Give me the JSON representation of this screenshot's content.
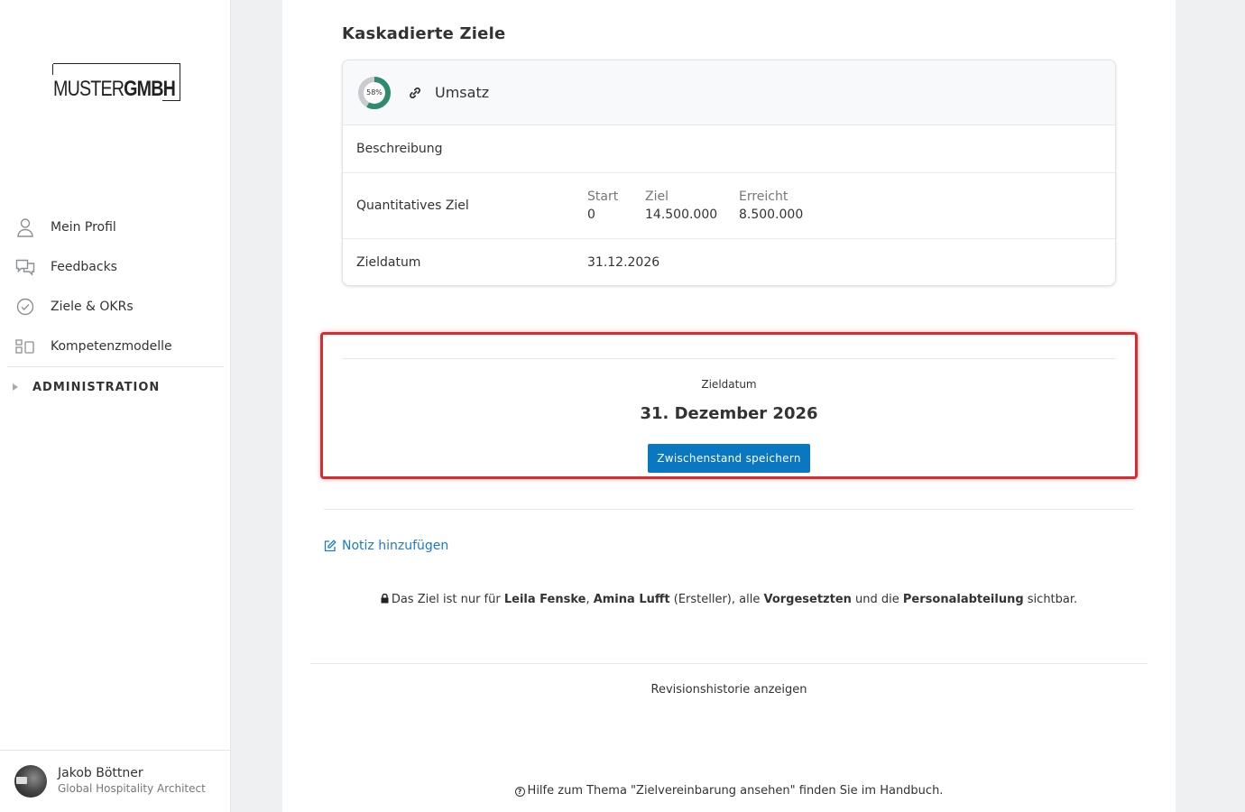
{
  "brand": {
    "logo_text_light": "MUSTER",
    "logo_text_bold": "GMBH"
  },
  "sidebar": {
    "items": [
      {
        "label": "Mein Profil",
        "icon": "user-icon"
      },
      {
        "label": "Feedbacks",
        "icon": "chat-icon"
      },
      {
        "label": "Ziele & OKRs",
        "icon": "check-circle-icon"
      },
      {
        "label": "Kompetenzmodelle",
        "icon": "blocks-icon"
      }
    ],
    "admin_label": "ADMINISTRATION"
  },
  "user": {
    "name": "Jakob Böttner",
    "role": "Global Hospitality Architect"
  },
  "main": {
    "section_title": "Kaskadierte Ziele",
    "goal_card": {
      "progress_percent": 58,
      "progress_label": "58%",
      "progress_color": "#2e8b6e",
      "title": "Umsatz",
      "description_label": "Beschreibung",
      "quant_label": "Quantitatives Ziel",
      "metrics": {
        "start_label": "Start",
        "start_value": "0",
        "target_label": "Ziel",
        "target_value": "14.500.000",
        "reached_label": "Erreicht",
        "reached_value": "8.500.000"
      },
      "date_label": "Zieldatum",
      "date_value": "31.12.2026"
    },
    "target_date_section": {
      "label": "Zieldatum",
      "value": "31. Dezember 2026",
      "save_button": "Zwischenstand speichern"
    },
    "add_note_link": "Notiz hinzufügen",
    "visibility": {
      "prefix": "Das Ziel ist nur für ",
      "person1": "Leila Fenske",
      "comma": ", ",
      "person2": "Amina Lufft",
      "creator_note": " (Ersteller), alle ",
      "supervisors": "Vorgesetzten",
      "and": " und die ",
      "hr": "Personalabteilung",
      "suffix": " sichtbar."
    },
    "revision_link": "Revisionshistorie anzeigen",
    "help_text": "Hilfe zum Thema \"Zielvereinbarung ansehen\" finden Sie im Handbuch."
  },
  "colors": {
    "primary_button": "#0a77c1",
    "link": "#1b7bc4",
    "highlight_border": "#d92b2f"
  }
}
